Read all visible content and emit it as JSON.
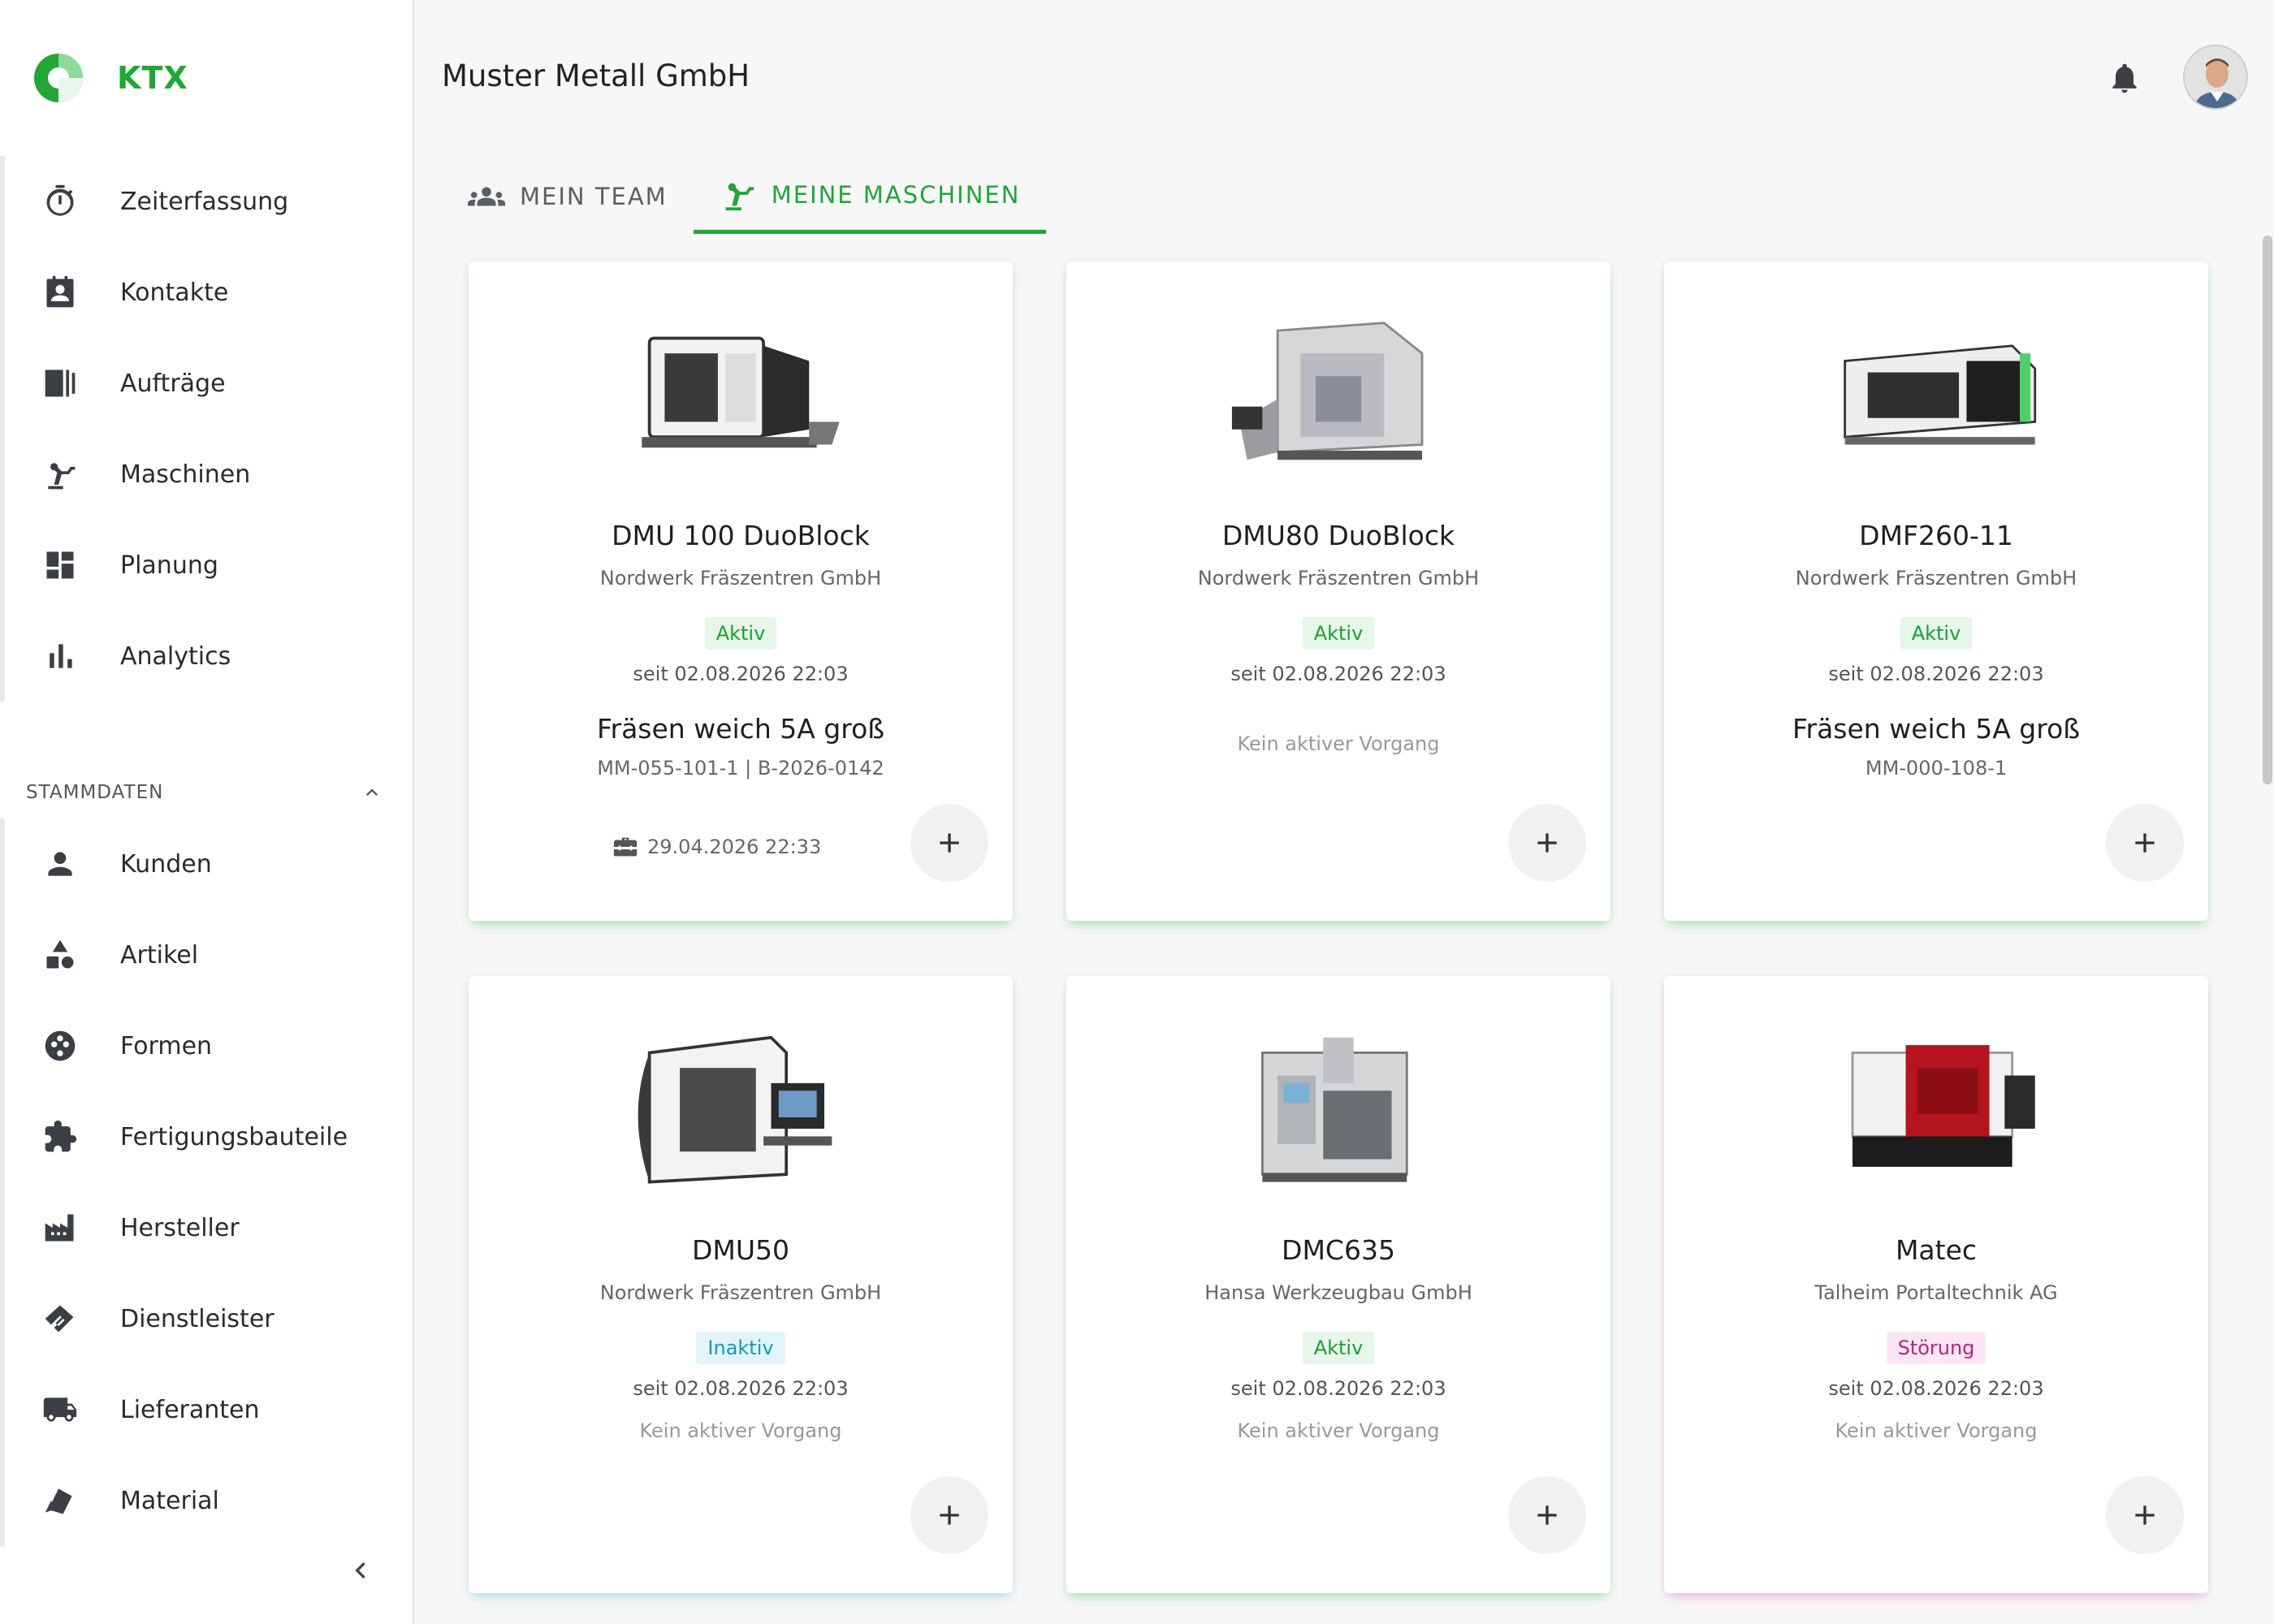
{
  "brand": {
    "name": "KTX",
    "color": "#21a637"
  },
  "nav": {
    "main": [
      {
        "label": "Zeiterfassung",
        "icon": "stopwatch-icon"
      },
      {
        "label": "Kontakte",
        "icon": "contact-card-icon"
      },
      {
        "label": "Aufträge",
        "icon": "orders-icon"
      },
      {
        "label": "Maschinen",
        "icon": "robot-arm-icon"
      },
      {
        "label": "Planung",
        "icon": "dashboard-icon"
      },
      {
        "label": "Analytics",
        "icon": "bar-chart-icon"
      }
    ],
    "section_title": "STAMMDATEN",
    "stamm": [
      {
        "label": "Kunden",
        "icon": "person-icon"
      },
      {
        "label": "Artikel",
        "icon": "shapes-icon"
      },
      {
        "label": "Formen",
        "icon": "mold-icon"
      },
      {
        "label": "Fertigungsbauteile",
        "icon": "puzzle-icon"
      },
      {
        "label": "Hersteller",
        "icon": "factory-icon"
      },
      {
        "label": "Dienstleister",
        "icon": "handshake-icon"
      },
      {
        "label": "Lieferanten",
        "icon": "truck-icon"
      },
      {
        "label": "Material",
        "icon": "material-icon"
      }
    ]
  },
  "header": {
    "title": "Muster Metall GmbH"
  },
  "tabs": [
    {
      "label": "MEIN TEAM",
      "icon": "team-icon",
      "active": false
    },
    {
      "label": "MEINE MASCHINEN",
      "icon": "robot-arm-icon",
      "active": true
    }
  ],
  "machines": [
    {
      "name": "DMU 100 DuoBlock",
      "company": "Nordwerk Fräszentren GmbH",
      "status": "Aktiv",
      "since": "seit 02.08.2026 22:03",
      "job": "Fräsen weich 5A groß",
      "job_ref": "MM-055-101-1 | B-2026-0142",
      "date": "29.04.2026 22:33"
    },
    {
      "name": "DMU80 DuoBlock",
      "company": "Nordwerk Fräszentren GmbH",
      "status": "Aktiv",
      "since": "seit 02.08.2026 22:03",
      "no_job": "Kein aktiver Vorgang"
    },
    {
      "name": "DMF260-11",
      "company": "Nordwerk Fräszentren GmbH",
      "status": "Aktiv",
      "since": "seit 02.08.2026 22:03",
      "job": "Fräsen weich 5A groß",
      "job_ref": "MM-000-108-1"
    },
    {
      "name": "DMU50",
      "company": "Nordwerk Fräszentren GmbH",
      "status": "Inaktiv",
      "since": "seit 02.08.2026 22:03",
      "no_job": "Kein aktiver Vorgang"
    },
    {
      "name": "DMC635",
      "company": "Hansa Werkzeugbau GmbH",
      "status": "Aktiv",
      "since": "seit 02.08.2026 22:03",
      "no_job": "Kein aktiver Vorgang"
    },
    {
      "name": "Matec",
      "company": "Talheim Portaltechnik AG",
      "status": "Störung",
      "since": "seit 02.08.2026 22:03",
      "no_job": "Kein aktiver Vorgang"
    }
  ],
  "colors": {
    "active_green": "#21a637",
    "inactive_blue": "#1797bc",
    "fault_pink": "#b32682"
  }
}
